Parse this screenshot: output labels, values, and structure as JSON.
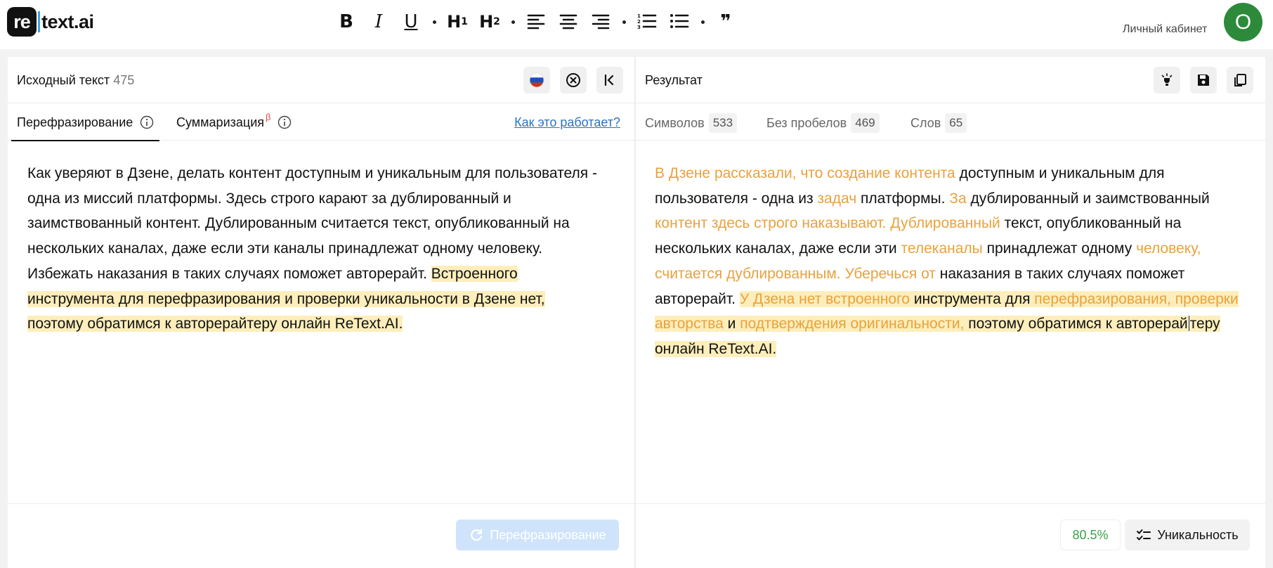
{
  "logo": {
    "mark": "re",
    "text": "text.ai"
  },
  "toolbar": {
    "bold": "B",
    "italic": "I",
    "underline": "U",
    "h1": "H",
    "h1_sub": "1",
    "h2": "H",
    "h2_sub": "2",
    "quote": "❞"
  },
  "header": {
    "cabinet": "Личный кабинет",
    "avatar_letter": "О"
  },
  "source": {
    "title": "Исходный текст",
    "count": "475",
    "tabs": [
      {
        "label": "Перефразирование"
      },
      {
        "label": "Суммаризация",
        "badge": "β"
      }
    ],
    "how_link": "Как это работает?",
    "text_plain": "Как уверяют в Дзене, делать контент доступным и уникальным для пользователя - одна из миссий платформы. Здесь строго карают за дублированный и заимствованный контент. Дублированным считается текст, опубликованный на нескольких каналах, даже если эти каналы принадлежат одному человеку. Избежать наказания в таких случаях поможет авторерайт. ",
    "text_highlight": "Встроенного инструмента для перефразирования и проверки уникальности в Дзене нет, поэтому обратимся  к авторерайтеру онлайн ReText.AI.",
    "action_button": "Перефразирование"
  },
  "result": {
    "title": "Результат",
    "stats": [
      {
        "label": "Символов",
        "value": "533"
      },
      {
        "label": "Без пробелов",
        "value": "469"
      },
      {
        "label": "Слов",
        "value": "65"
      }
    ],
    "segments": {
      "s1": "В Дзене рассказали, что создание контента",
      "s2": " доступным и уникальным для пользователя - одна из ",
      "s3": "задач",
      "s4": " платформы. ",
      "s5": "За",
      "s6": " дублированный и заимствованный ",
      "s7": "контент здесь строго наказывают. Дублированный",
      "s8": " текст, опубликованный на нескольких каналах, даже если эти ",
      "s9": "телеканалы",
      "s10": " принадлежат одному ",
      "s11": "человеку, считается дублированным. Уберечься от",
      "s12": " наказания в таких случаях поможет авторерайт. ",
      "h1": "У Дзена нет встроенного",
      "h2": " инструмента для ",
      "h3": "перефразирования, проверки авторства",
      "h4": " и ",
      "h5": "подтверждения оригинальности,",
      "h6": " поэтому обратимся к авторерай",
      "h7": "теру онлайн ReText.AI."
    },
    "score": "80.5%",
    "uniq_button": "Уникальность"
  }
}
